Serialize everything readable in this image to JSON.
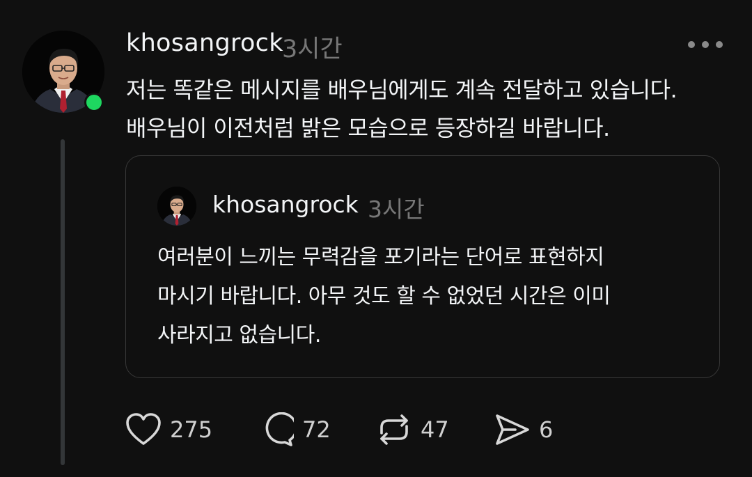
{
  "post": {
    "username": "khosangrock",
    "timestamp": "3시간",
    "text_lines": [
      "저는 똑같은 메시지를 배우님에게도 계속 전달하고 있습니다.",
      "배우님이 이전처럼 밝은 모습으로 등장하길 바랍니다."
    ],
    "online_color": "#1ed760"
  },
  "quote": {
    "username": "khosangrock",
    "timestamp": "3시간",
    "text_lines": [
      "여러분이 느끼는 무력감을 포기라는 단어로 표현하지",
      "마시기 바랍니다.  아무 것도 할 수 없었던 시간은 이미",
      "사라지고 없습니다."
    ]
  },
  "actions": {
    "like_count": "275",
    "comment_count": "72",
    "repost_count": "47",
    "share_count": "6",
    "icons": [
      "heart-icon",
      "comment-icon",
      "repost-icon",
      "share-icon"
    ]
  }
}
